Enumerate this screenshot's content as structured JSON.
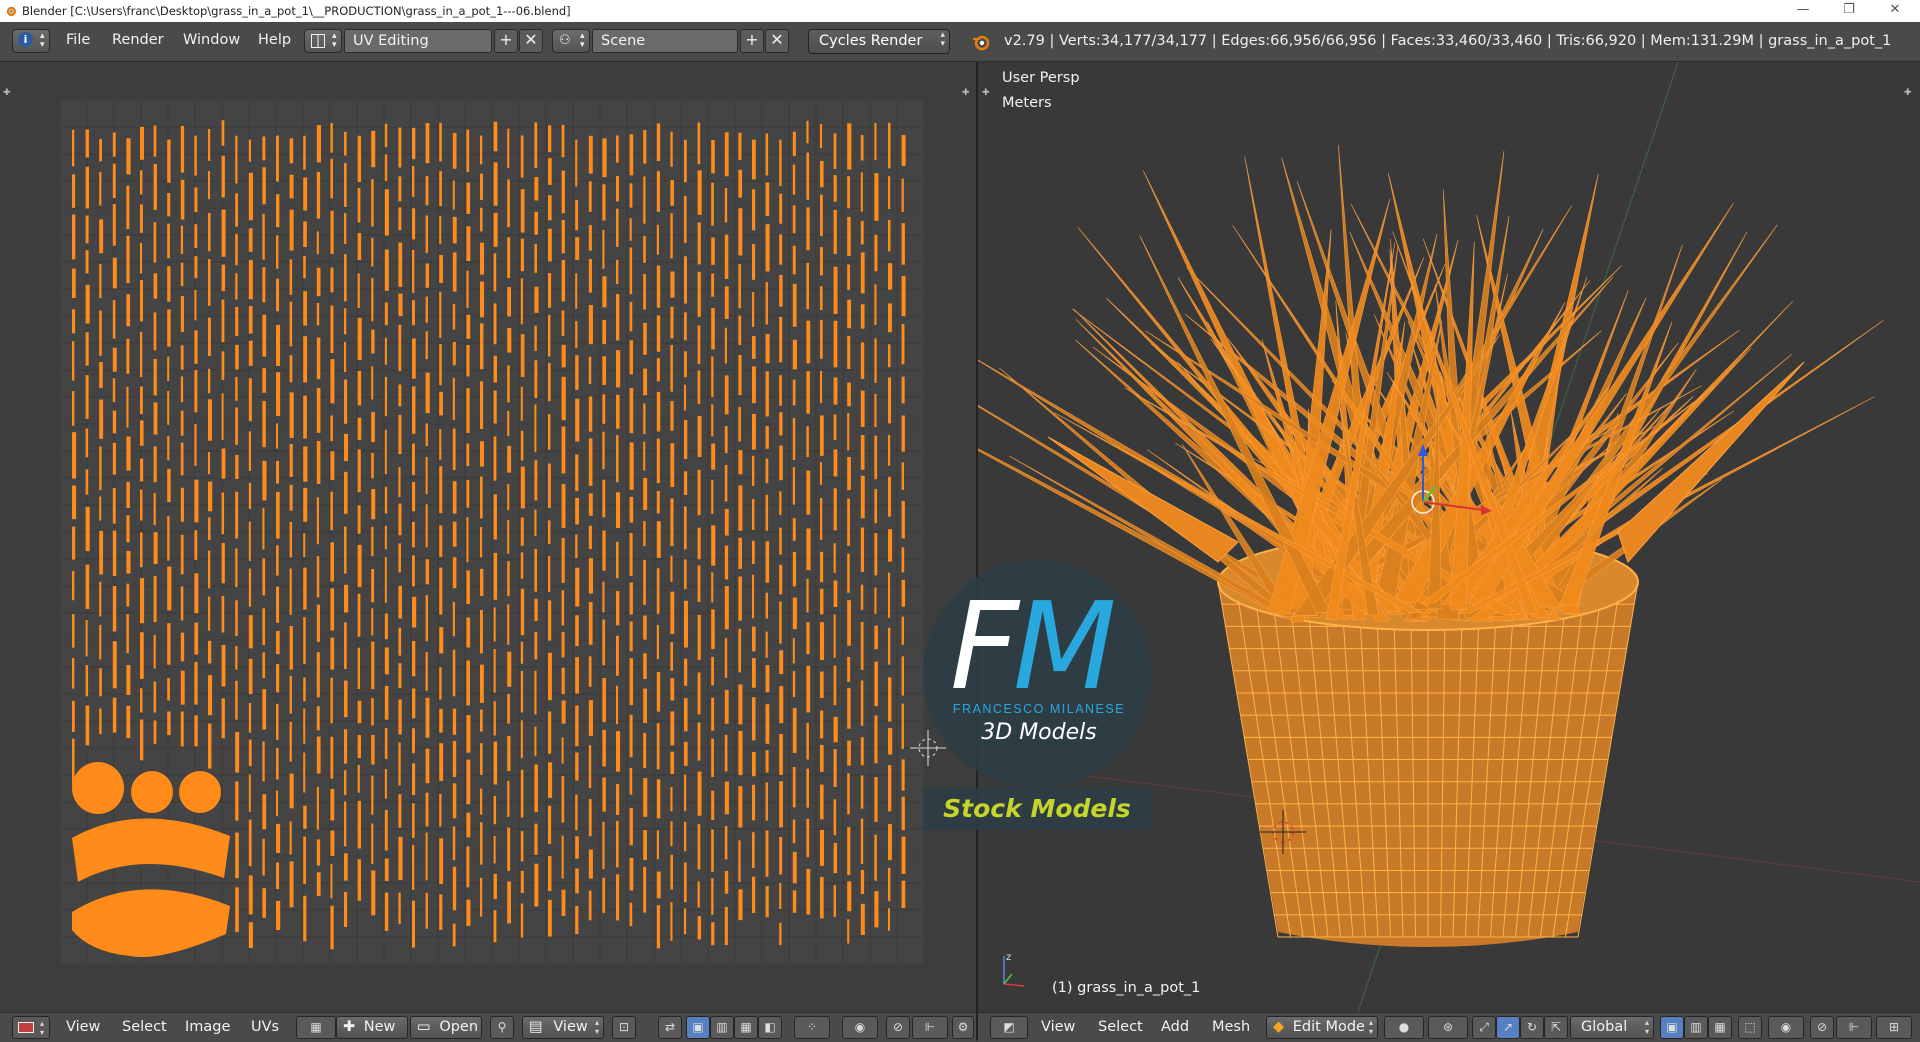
{
  "window": {
    "title": "Blender [C:\\Users\\franc\\Desktop\\grass_in_a_pot_1\\__PRODUCTION\\grass_in_a_pot_1---06.blend]",
    "controls": [
      "—",
      "❐",
      "✕"
    ]
  },
  "info_header": {
    "menus": [
      "File",
      "Render",
      "Window",
      "Help"
    ],
    "screen_layout": "UV Editing",
    "scene": "Scene",
    "render_engine": "Cycles Render",
    "stats": "v2.79 | Verts:34,177/34,177 | Edges:66,956/66,956 | Faces:33,460/33,460 | Tris:66,920 | Mem:131.29M | grass_in_a_pot_1"
  },
  "viewport": {
    "view_name": "User Persp",
    "units": "Meters",
    "object_label": "(1) grass_in_a_pot_1"
  },
  "uv_editor_header": {
    "menus": [
      "View",
      "Select",
      "Image",
      "UVs"
    ],
    "new_label": "New",
    "open_label": "Open",
    "view_label": "View"
  },
  "view3d_header": {
    "menus": [
      "View",
      "Select",
      "Add",
      "Mesh"
    ],
    "mode": "Edit Mode",
    "orientation": "Global"
  },
  "watermark": {
    "logo_f": "F",
    "logo_m": "M",
    "name": "FRANCESCO MILANESE",
    "subtitle": "3D Models",
    "banner": "Stock Models"
  },
  "colors": {
    "selection_orange": "#ff8c1a",
    "background": "#3d3d3d",
    "header": "#4a4a4a",
    "accent_blue": "#5680c2",
    "watermark_blue": "#29a8de",
    "watermark_green": "#c6d52a"
  }
}
